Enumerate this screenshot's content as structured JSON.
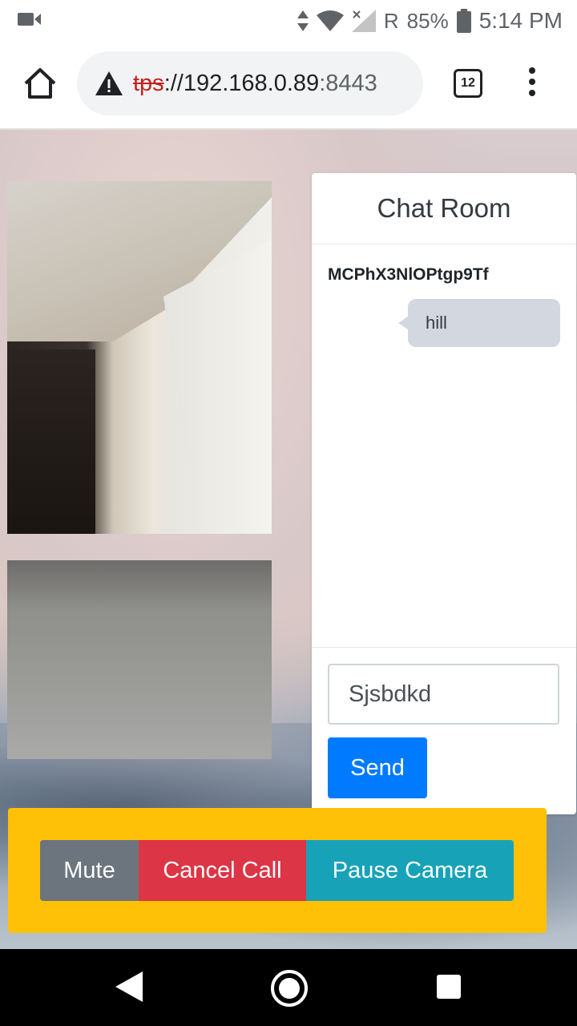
{
  "status_bar": {
    "network_label": "R",
    "battery": "85%",
    "time": "5:14 PM"
  },
  "browser": {
    "url_scheme": "tps",
    "url_rest": "://192.168.0.89",
    "url_port": ":8443",
    "tab_count": "12"
  },
  "chat": {
    "title": "Chat Room",
    "messages": [
      {
        "user": "MCPhX3NlOPtgp9Tf",
        "text": "hill"
      }
    ],
    "input_value": "Sjsbdkd",
    "send_label": "Send"
  },
  "controls": {
    "mute_label": "Mute",
    "cancel_label": "Cancel Call",
    "pause_label": "Pause Camera"
  },
  "colors": {
    "primary": "#007bff",
    "danger": "#dc3545",
    "info": "#17a2b8",
    "secondary": "#6c757d",
    "warning": "#ffc107"
  }
}
